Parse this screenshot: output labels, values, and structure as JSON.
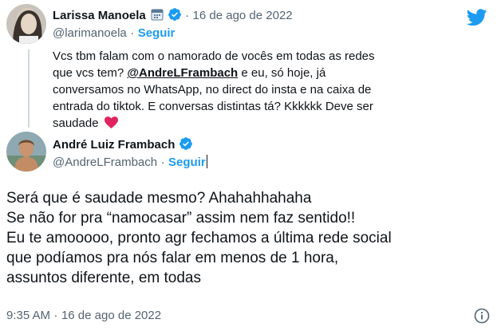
{
  "tweet1": {
    "name": "Larissa Manoela",
    "handle": "@larimanoela",
    "follow": "Seguir",
    "separator": "·",
    "date": "16 de ago de 2022",
    "text_a": "Vcs tbm falam com o namorado de vocês em todas as redes que vcs tem? ",
    "mention": "@AndreLFrambach",
    "text_b": " e eu, só hoje, já conversamos no WhatsApp, no direct do insta e na caixa de entrada do tiktok. E conversas distintas tá? Kkkkkk Deve ser saudade",
    "emoji": "heart-emoji"
  },
  "tweet2": {
    "name": "André Luiz Frambach",
    "handle": "@AndreLFrambach",
    "follow": "Seguir",
    "separator": "·",
    "lines": [
      "Será que é saudade mesmo? Ahahahhahaha",
      "Se não for pra “namocasar” assim nem faz sentido!!",
      "Eu te amooooo, pronto agr fechamos a última rede social",
      "que podíamos pra nós falar em menos de 1 hora,",
      "assuntos diferente, em todas"
    ],
    "time": "9:35 AM",
    "date": "16 de ago de 2022"
  },
  "icons": {
    "brand": "twitter-bird-icon",
    "verified": "verified-badge-icon",
    "info": "info-icon",
    "calendar": "calendar-emoji-icon"
  },
  "colors": {
    "twitter_blue": "#1d9bf0",
    "heart_red": "#e0245e",
    "text": "#0f1419",
    "secondary": "#536471"
  }
}
